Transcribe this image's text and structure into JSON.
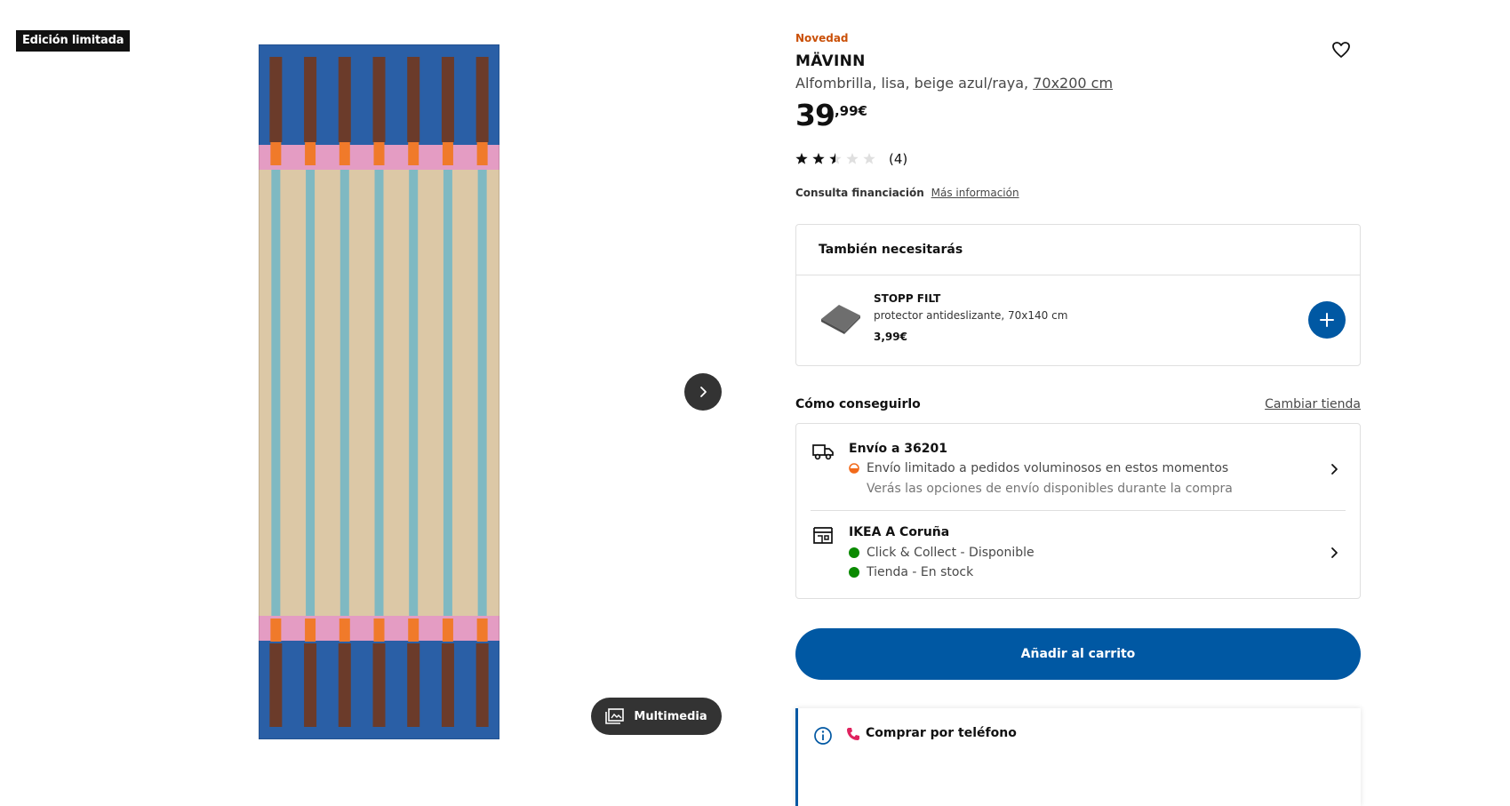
{
  "badge": "Edición limitada",
  "gallery": {
    "next_icon": "chevron-right-icon",
    "multimedia_label": "Multimedia",
    "multimedia_icon": "media-gallery-icon"
  },
  "product": {
    "label_new": "Novedad",
    "name": "MÄVINN",
    "description": "Alfombrilla, lisa, beige azul/raya,",
    "size": "70x200 cm",
    "price_integer": "39",
    "price_decimal": ",99€",
    "rating": 2.5,
    "rating_max": 5,
    "review_count": "(4)",
    "favorite_icon": "heart-icon"
  },
  "financing": {
    "label": "Consulta financiación",
    "link": "Más información"
  },
  "also_need": {
    "title": "También necesitarás",
    "item": {
      "name": "STOPP FILT",
      "description": "protector antideslizante, 70x140 cm",
      "price": "3,99€"
    }
  },
  "get_it": {
    "title": "Cómo conseguirlo",
    "change_store": "Cambiar tienda",
    "delivery": {
      "title": "Envío a 36201",
      "status": "Envío limitado a pedidos voluminosos en estos momentos",
      "note": "Verás las opciones de envío disponibles durante la compra"
    },
    "store": {
      "title": "IKEA A Coruña",
      "click_collect": "Click & Collect - Disponible",
      "in_store": "Tienda - En stock"
    }
  },
  "add_to_cart": "Añadir al carrito",
  "phone_order": "Comprar por teléfono",
  "colors": {
    "brand_blue": "#0058a3",
    "new_orange": "#ca5008",
    "available_green": "#0a8a00",
    "rug_blue": "#2a5fa6",
    "rug_brown": "#6b3b2a",
    "rug_pink": "#e49cc3",
    "rug_orange": "#f07a2a",
    "rug_beige": "#dcc8a6",
    "rug_teal": "#7fb9c2"
  }
}
